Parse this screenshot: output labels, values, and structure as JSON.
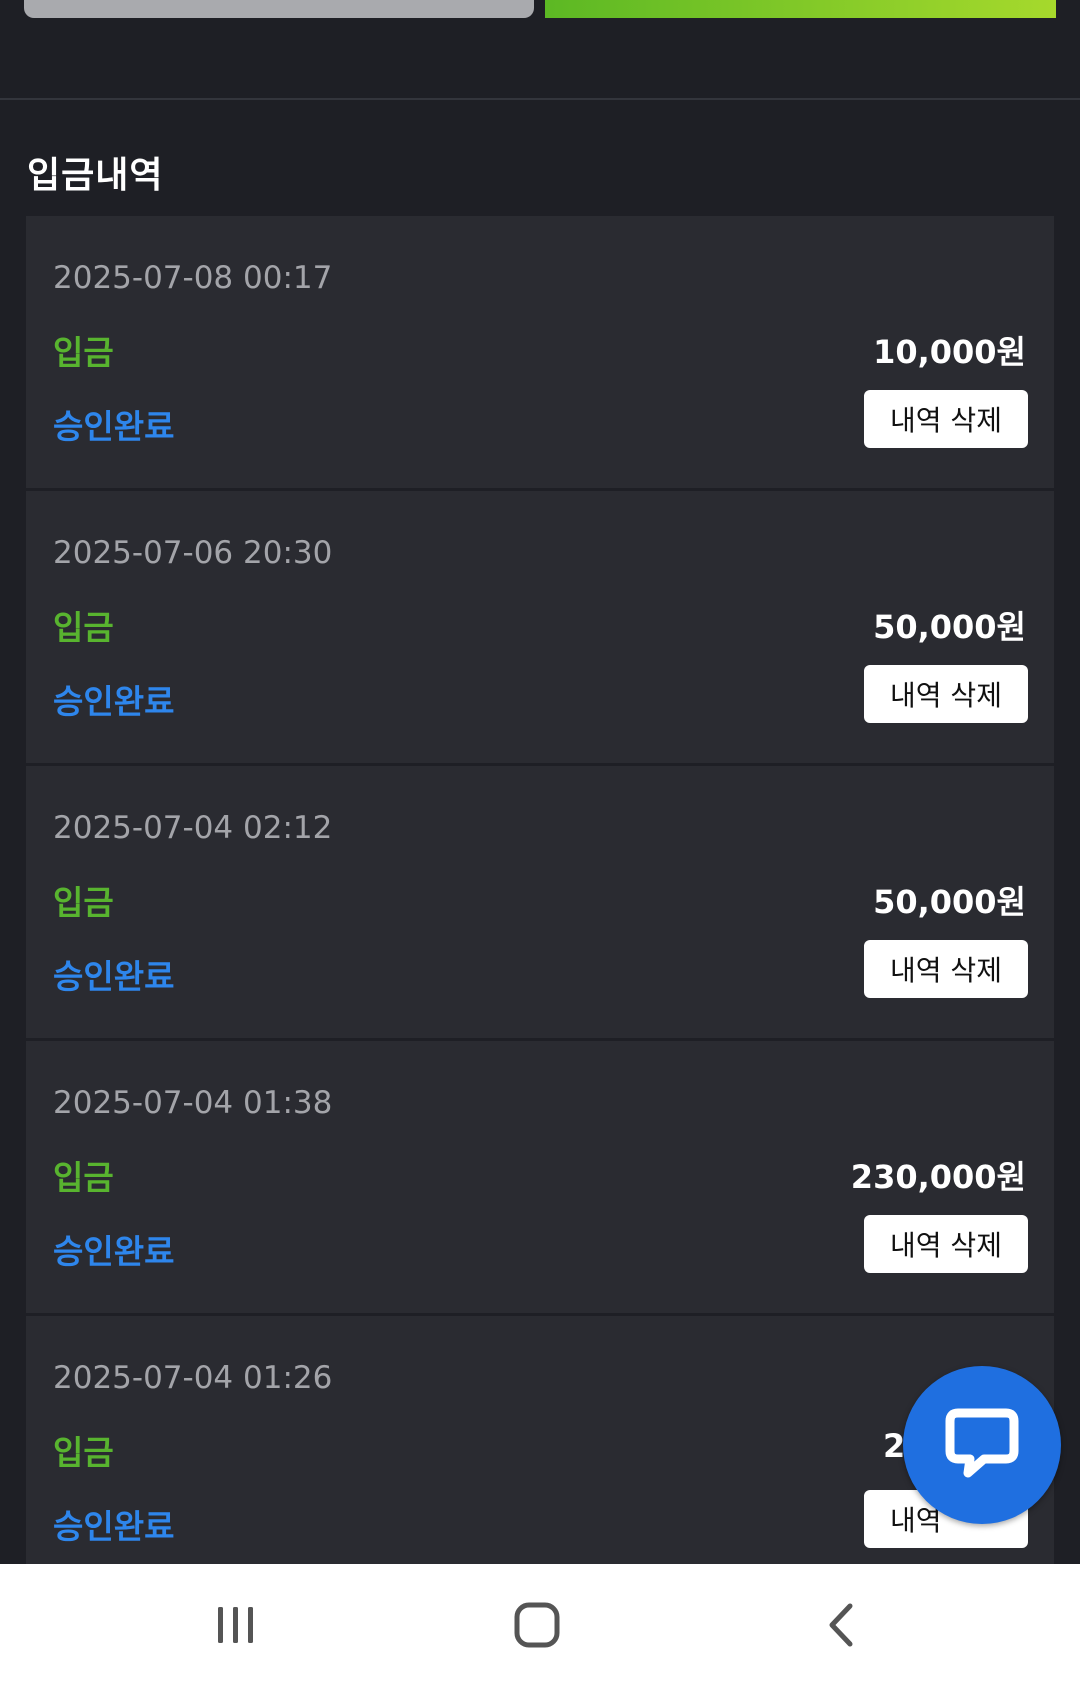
{
  "section_title": "입금내역",
  "records": [
    {
      "date": "2025-07-08 00:17",
      "type": "입금",
      "amount": "10,000원",
      "status": "승인완료",
      "delete_label": "내역 삭제"
    },
    {
      "date": "2025-07-06 20:30",
      "type": "입금",
      "amount": "50,000원",
      "status": "승인완료",
      "delete_label": "내역 삭제"
    },
    {
      "date": "2025-07-04 02:12",
      "type": "입금",
      "amount": "50,000원",
      "status": "승인완료",
      "delete_label": "내역 삭제"
    },
    {
      "date": "2025-07-04 01:38",
      "type": "입금",
      "amount": "230,000원",
      "status": "승인완료",
      "delete_label": "내역 삭제"
    },
    {
      "date": "2025-07-04 01:26",
      "type": "입금",
      "amount": "2",
      "status": "승인완료",
      "delete_label": "내역"
    }
  ],
  "chat_button": {
    "icon": "chat-bubble-icon"
  },
  "navbar": {
    "recent_icon": "recent-apps-icon",
    "home_icon": "home-icon",
    "back_icon": "back-icon"
  },
  "colors": {
    "background": "#1e1f25",
    "card": "#2a2b31",
    "type_green": "#58b42f",
    "status_blue": "#2e86ec",
    "fab_blue": "#1f6fe0",
    "accent_green": "#5cb824"
  }
}
